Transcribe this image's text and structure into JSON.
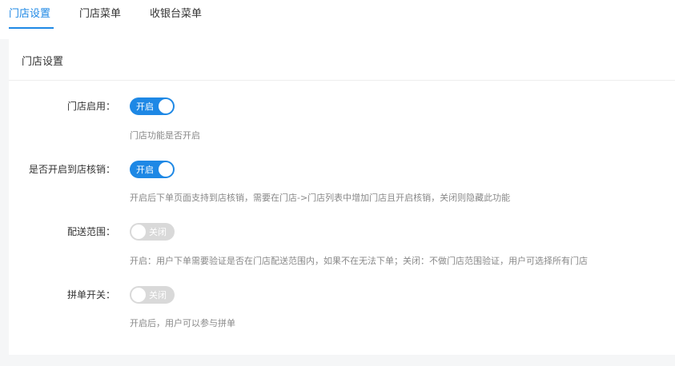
{
  "tabs": [
    {
      "label": "门店设置",
      "active": true
    },
    {
      "label": "门店菜单",
      "active": false
    },
    {
      "label": "收银台菜单",
      "active": false
    }
  ],
  "card": {
    "title": "门店设置"
  },
  "settings": [
    {
      "label": "门店启用：",
      "state": "on",
      "switch_text": "开启",
      "hint": "门店功能是否开启"
    },
    {
      "label": "是否开启到店核销：",
      "state": "on",
      "switch_text": "开启",
      "hint": "开启后下单页面支持到店核销，需要在门店->门店列表中增加门店且开启核销，关闭则隐藏此功能"
    },
    {
      "label": "配送范围：",
      "state": "off",
      "switch_text": "关闭",
      "hint": "开启：用户下单需要验证是否在门店配送范围内，如果不在无法下单；关闭：不做门店范围验证，用户可选择所有门店"
    },
    {
      "label": "拼单开关：",
      "state": "off",
      "switch_text": "关闭",
      "hint": "开启后，用户可以参与拼单"
    }
  ],
  "colors": {
    "accent": "#1e88e5",
    "switch_off": "#d9d9d9",
    "hint_text": "#888888",
    "page_background": "#f5f6f7"
  }
}
